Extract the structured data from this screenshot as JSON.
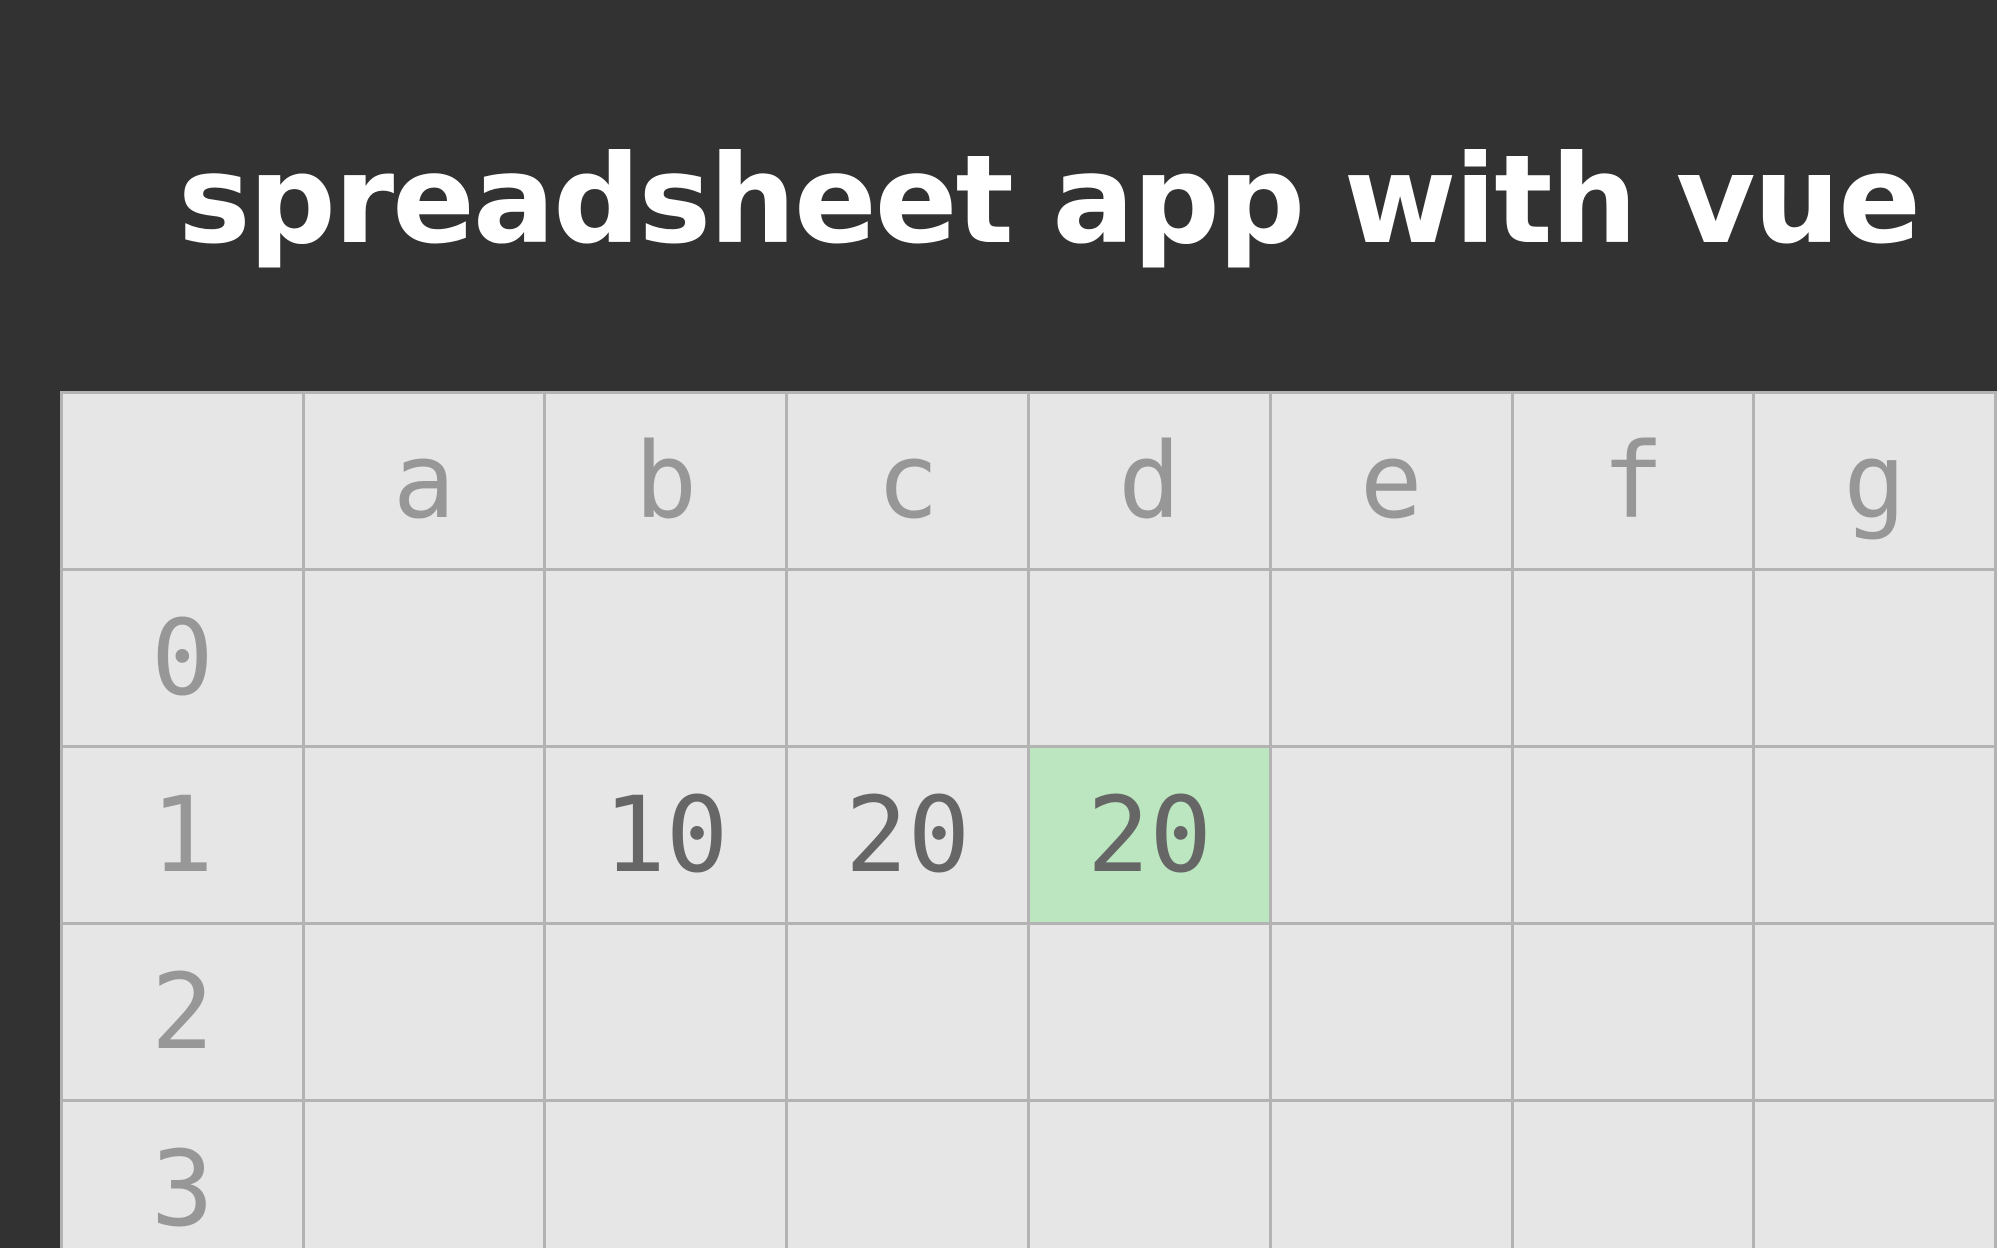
{
  "title": "spreadsheet app with vue",
  "colors": {
    "background": "#323232",
    "cell_background": "#e6e6e6",
    "grid_line": "#b3b3b3",
    "header_text": "#979797",
    "cell_text": "#666666",
    "selected_cell": "#bbe6bf"
  },
  "columns": [
    "a",
    "b",
    "c",
    "d",
    "e",
    "f",
    "g"
  ],
  "rows": [
    {
      "label": "0",
      "cells": [
        "",
        "",
        "",
        "",
        "",
        "",
        ""
      ]
    },
    {
      "label": "1",
      "cells": [
        "",
        "10",
        "20",
        "20",
        "",
        "",
        ""
      ]
    },
    {
      "label": "2",
      "cells": [
        "",
        "",
        "",
        "",
        "",
        "",
        ""
      ]
    },
    {
      "label": "3",
      "cells": [
        "",
        "",
        "",
        "",
        "",
        "",
        ""
      ]
    }
  ],
  "selected": {
    "row": 1,
    "column": "d"
  }
}
